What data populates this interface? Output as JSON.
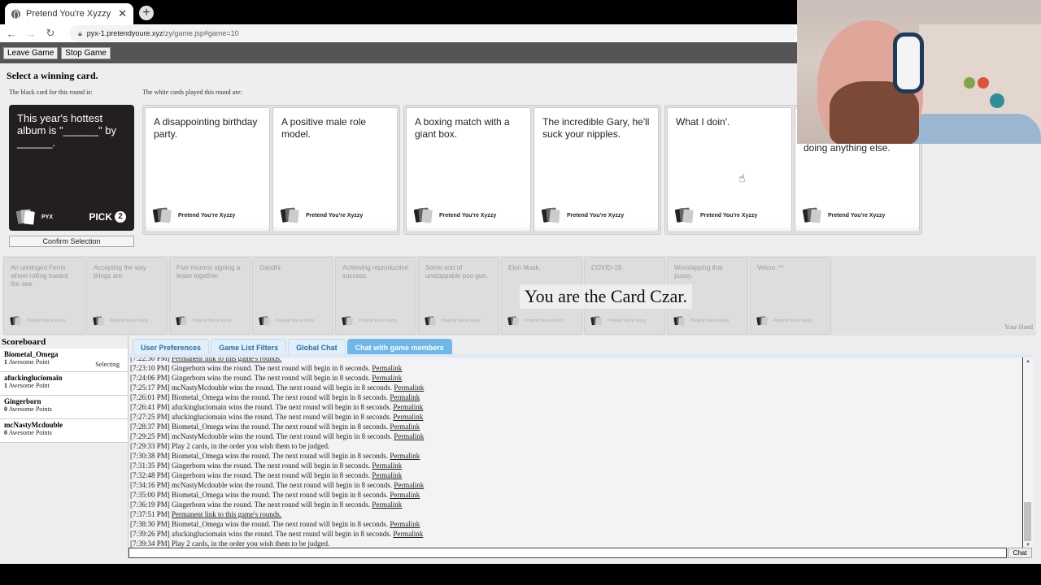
{
  "browser": {
    "tab_title": "Pretend You're Xyzzy",
    "url_host": "pyx-1.pretendyoure.xyz",
    "url_path": "/zy/game.jsp#game=10"
  },
  "toolbar": {
    "leave_label": "Leave Game",
    "stop_label": "Stop Game"
  },
  "round": {
    "heading": "Select a winning card.",
    "black_label": "The black card for this round is:",
    "white_label": "The white cards played this round are:",
    "black_card": {
      "text": "This year's hottest album is \"______\" by ______.",
      "source": "PYX",
      "pick_label": "PICK",
      "pick": "2"
    },
    "confirm_label": "Confirm Selection",
    "groups": [
      {
        "cards": [
          {
            "text": "A disappointing birthday party.",
            "source": "Pretend You're Xyzzy"
          },
          {
            "text": "A positive male role model.",
            "source": "Pretend You're Xyzzy"
          }
        ]
      },
      {
        "cards": [
          {
            "text": "A boxing match with a giant box.",
            "source": "Pretend You're Xyzzy"
          },
          {
            "text": "The incredible Gary, he'll suck your nipples.",
            "source": "Pretend You're Xyzzy"
          }
        ]
      },
      {
        "cards": [
          {
            "text": "What I doin'.",
            "source": "Pretend You're Xyzzy"
          },
          {
            "text": "doing anything else.",
            "source": "Pretend You're Xyzzy"
          }
        ]
      }
    ]
  },
  "hand": {
    "label": "Your Hand",
    "czar_message": "You are the Card Czar.",
    "cards": [
      {
        "text": "An unhinged Ferris wheel rolling toward the sea",
        "source": "Pretend You're Xyzzy"
      },
      {
        "text": "Accepting the way things are.",
        "source": "Pretend You're Xyzzy"
      },
      {
        "text": "Five morons signing a lease together.",
        "source": "Pretend You're Xyzzy"
      },
      {
        "text": "Gandhi.",
        "source": "Pretend You're Xyzzy"
      },
      {
        "text": "Achieving reproductive success.",
        "source": "Pretend You're Xyzzy"
      },
      {
        "text": "Some sort of unstoppable poo gun.",
        "source": "Pretend You're Xyzzy"
      },
      {
        "text": "Elon Musk.",
        "source": "Pretend You're Xyzzy"
      },
      {
        "text": "COVID-19.",
        "source": "Pretend You're Xyzzy"
      },
      {
        "text": "Worshipping that pussy.",
        "source": "Pretend You're Xyzzy"
      },
      {
        "text": "Velcro.™",
        "source": "Pretend You're Xyzzy"
      }
    ]
  },
  "scoreboard": {
    "title": "Scoreboard",
    "players": [
      {
        "name": "Biometal_Omega",
        "points": "1",
        "unit": "Awesome Point",
        "status": "Selecting"
      },
      {
        "name": "afuckingluciomain",
        "points": "1",
        "unit": "Awesome Point",
        "status": ""
      },
      {
        "name": "Gingerborn",
        "points": "0",
        "unit": "Awesome Points",
        "status": ""
      },
      {
        "name": "mcNastyMcdouble",
        "points": "0",
        "unit": "Awesome Points",
        "status": ""
      }
    ]
  },
  "chat": {
    "tabs": [
      "User Preferences",
      "Game List Filters",
      "Global Chat",
      "Chat with game members"
    ],
    "active_tab": 3,
    "send_label": "Chat",
    "input_value": "",
    "lines": [
      {
        "time": "[7:22:30 PM]",
        "text": "",
        "link": "Permanent link to this game's rounds."
      },
      {
        "time": "[7:23:10 PM]",
        "text": "Gingerborn wins the round. The next round will begin in 8 seconds.",
        "link": "Permalink"
      },
      {
        "time": "[7:24:06 PM]",
        "text": "Gingerborn wins the round. The next round will begin in 8 seconds.",
        "link": "Permalink"
      },
      {
        "time": "[7:25:17 PM]",
        "text": "mcNastyMcdouble wins the round. The next round will begin in 8 seconds.",
        "link": "Permalink"
      },
      {
        "time": "[7:26:01 PM]",
        "text": "Biometal_Omega wins the round. The next round will begin in 8 seconds.",
        "link": "Permalink"
      },
      {
        "time": "[7:26:41 PM]",
        "text": "afuckingluciomain wins the round. The next round will begin in 8 seconds.",
        "link": "Permalink"
      },
      {
        "time": "[7:27:25 PM]",
        "text": "afuckingluciomain wins the round. The next round will begin in 8 seconds.",
        "link": "Permalink"
      },
      {
        "time": "[7:28:37 PM]",
        "text": "Biometal_Omega wins the round. The next round will begin in 8 seconds.",
        "link": "Permalink"
      },
      {
        "time": "[7:29:25 PM]",
        "text": "mcNastyMcdouble wins the round. The next round will begin in 8 seconds.",
        "link": "Permalink"
      },
      {
        "time": "[7:29:33 PM]",
        "text": "Play 2 cards, in the order you wish them to be judged.",
        "link": ""
      },
      {
        "time": "[7:30:38 PM]",
        "text": "Biometal_Omega wins the round. The next round will begin in 8 seconds.",
        "link": "Permalink"
      },
      {
        "time": "[7:31:35 PM]",
        "text": "Gingerborn wins the round. The next round will begin in 8 seconds.",
        "link": "Permalink"
      },
      {
        "time": "[7:32:48 PM]",
        "text": "Gingerborn wins the round. The next round will begin in 8 seconds.",
        "link": "Permalink"
      },
      {
        "time": "[7:34:16 PM]",
        "text": "mcNastyMcdouble wins the round. The next round will begin in 8 seconds.",
        "link": "Permalink"
      },
      {
        "time": "[7:35:00 PM]",
        "text": "Biometal_Omega wins the round. The next round will begin in 8 seconds.",
        "link": "Permalink"
      },
      {
        "time": "[7:36:19 PM]",
        "text": "Gingerborn wins the round. The next round will begin in 8 seconds.",
        "link": "Permalink"
      },
      {
        "time": "[7:37:51 PM]",
        "text": "",
        "link": "Permanent link to this game's rounds."
      },
      {
        "time": "[7:38:30 PM]",
        "text": "Biometal_Omega wins the round. The next round will begin in 8 seconds.",
        "link": "Permalink"
      },
      {
        "time": "[7:39:26 PM]",
        "text": "afuckingluciomain wins the round. The next round will begin in 8 seconds.",
        "link": "Permalink"
      },
      {
        "time": "[7:39:34 PM]",
        "text": "Play 2 cards, in the order you wish them to be judged.",
        "link": ""
      }
    ]
  }
}
